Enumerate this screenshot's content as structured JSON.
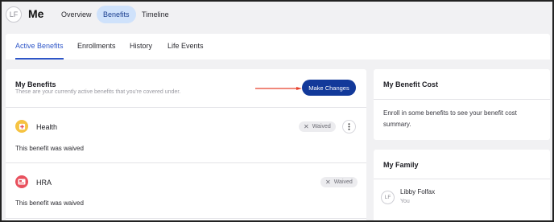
{
  "header": {
    "avatar_initials": "LF",
    "title": "Me",
    "nav": [
      {
        "label": "Overview",
        "active": false
      },
      {
        "label": "Benefits",
        "active": true
      },
      {
        "label": "Timeline",
        "active": false
      }
    ]
  },
  "subtabs": [
    {
      "label": "Active Benefits",
      "active": true
    },
    {
      "label": "Enrollments",
      "active": false
    },
    {
      "label": "History",
      "active": false
    },
    {
      "label": "Life Events",
      "active": false
    }
  ],
  "my_benefits": {
    "title": "My Benefits",
    "subtitle": "These are your currently active benefits that you're covered under.",
    "make_changes_label": "Make Changes",
    "annotation_arrow_color": "#e8402c",
    "items": [
      {
        "name": "Health",
        "icon": "health-icon",
        "status": "Waived",
        "note": "This benefit was waived",
        "icon_color": "#f6c342"
      },
      {
        "name": "HRA",
        "icon": "hra-icon",
        "status": "Waived",
        "note": "This benefit was waived",
        "icon_color": "#e8515e"
      }
    ]
  },
  "benefit_cost": {
    "title": "My Benefit Cost",
    "text": "Enroll in some benefits to see your benefit cost summary."
  },
  "family": {
    "title": "My Family",
    "members": [
      {
        "initials": "LF",
        "name": "Libby Folfax",
        "relation": "You"
      }
    ]
  },
  "colors": {
    "accent": "#2e56c8",
    "primary_button": "#12399a",
    "active_nav_bg": "#cfe2fb"
  }
}
